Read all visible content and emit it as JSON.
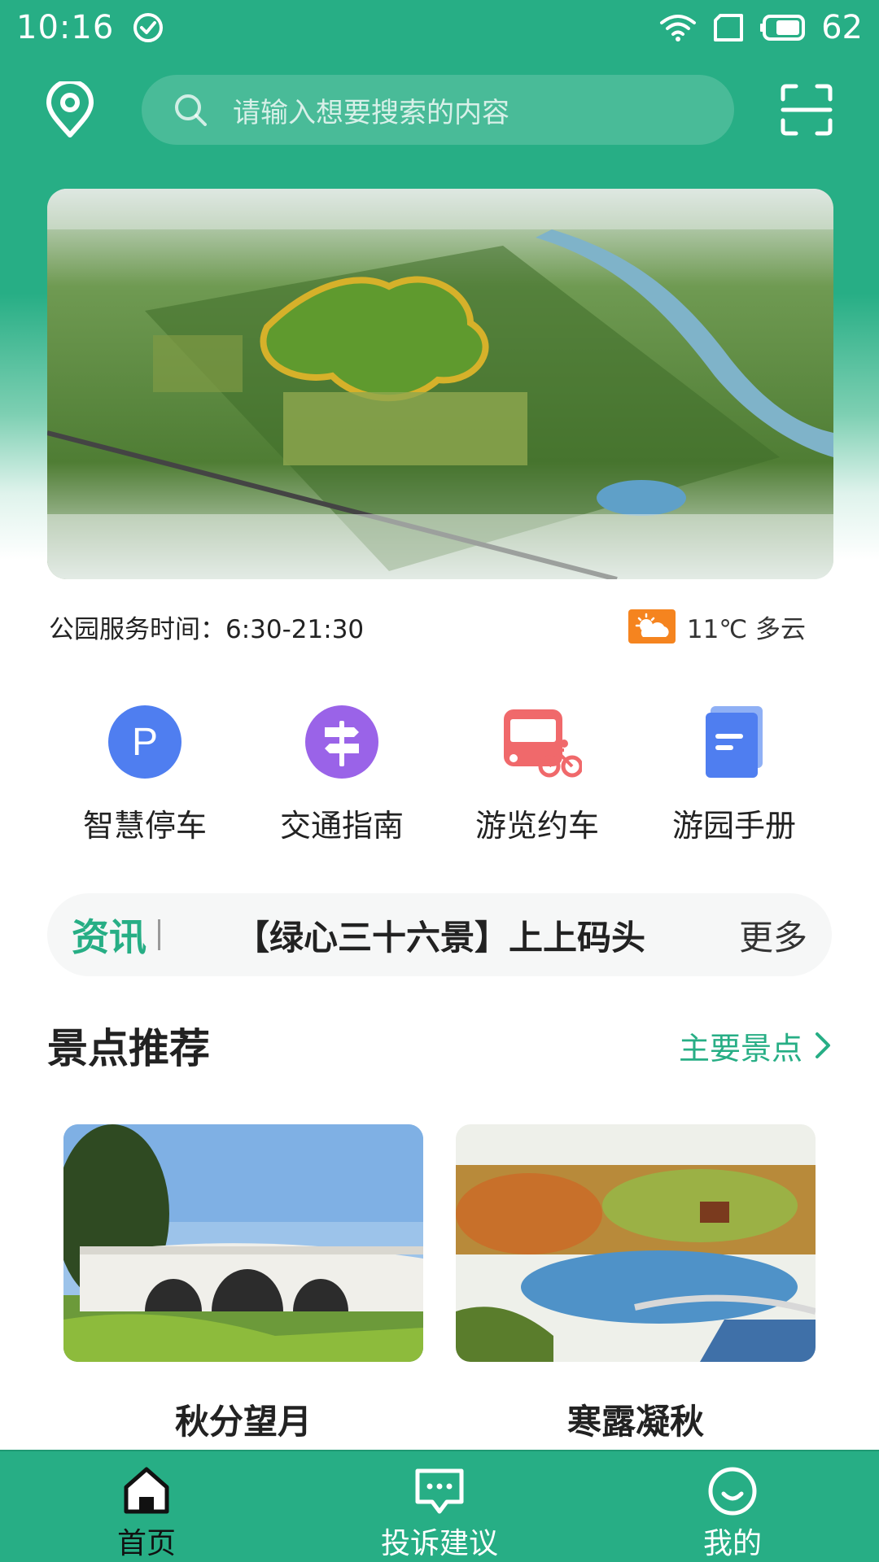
{
  "status_bar": {
    "time": "10:16",
    "battery": "62"
  },
  "header": {
    "search_placeholder": "请输入想要搜索的内容"
  },
  "service": {
    "text": "公园服务时间：6:30-21:30"
  },
  "weather": {
    "text": "11℃ 多云"
  },
  "quick_actions": [
    {
      "label": "智慧停车",
      "icon": "parking-icon"
    },
    {
      "label": "交通指南",
      "icon": "signpost-icon"
    },
    {
      "label": "游览约车",
      "icon": "bus-bike-icon"
    },
    {
      "label": "游园手册",
      "icon": "handbook-icon"
    }
  ],
  "news": {
    "tag": "资讯",
    "title": "【绿心三十六景】上上码头",
    "more": "更多"
  },
  "section": {
    "title": "景点推荐",
    "link": "主要景点"
  },
  "cards": [
    {
      "title": "秋分望月"
    },
    {
      "title": "寒露凝秋"
    }
  ],
  "tabs": [
    {
      "label": "首页",
      "icon": "home-icon",
      "active": true
    },
    {
      "label": "投诉建议",
      "icon": "message-icon",
      "active": false
    },
    {
      "label": "我的",
      "icon": "profile-icon",
      "active": false
    }
  ],
  "colors": {
    "brand": "#27ae85",
    "weather_badge": "#f5841f"
  }
}
